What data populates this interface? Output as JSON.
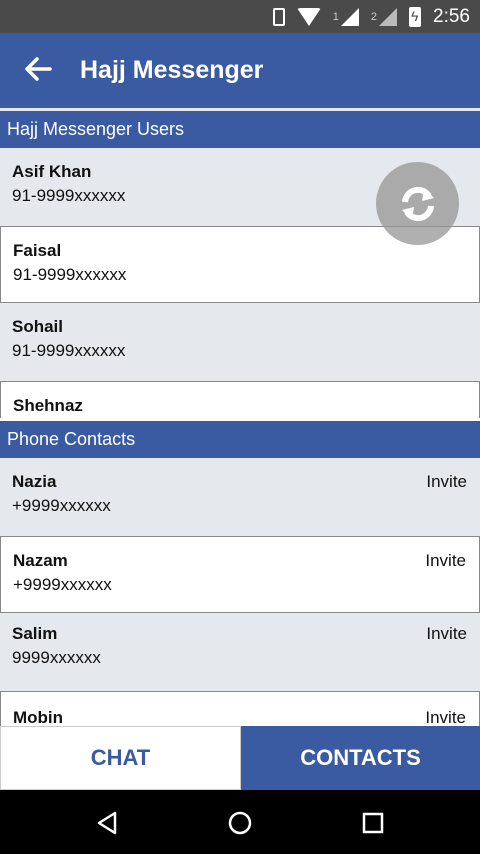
{
  "status_bar": {
    "sim1": "1",
    "sim2": "2",
    "time": "2:56"
  },
  "app_bar": {
    "title": "Hajj Messenger"
  },
  "sections": {
    "users_header": "Hajj Messenger Users",
    "contacts_header": "Phone Contacts"
  },
  "users": [
    {
      "name": "Asif Khan",
      "phone": "91-9999xxxxxx"
    },
    {
      "name": "Faisal",
      "phone": "91-9999xxxxxx"
    },
    {
      "name": "Sohail",
      "phone": "91-9999xxxxxx"
    },
    {
      "name": "Shehnaz",
      "phone": ""
    }
  ],
  "contacts": [
    {
      "name": "Nazia",
      "phone": "+9999xxxxxx",
      "action": "Invite"
    },
    {
      "name": "Nazam",
      "phone": "+9999xxxxxx",
      "action": "Invite"
    },
    {
      "name": "Salim",
      "phone": "9999xxxxxx",
      "action": "Invite"
    },
    {
      "name": "Mobin",
      "phone": "",
      "action": "Invite"
    }
  ],
  "tabs": {
    "chat": "CHAT",
    "contacts": "CONTACTS"
  },
  "colors": {
    "primary": "#3a5aa2",
    "list_bg": "#e5e8ec"
  },
  "icons": {
    "back": "arrow-left-icon",
    "refresh": "sync-icon"
  }
}
